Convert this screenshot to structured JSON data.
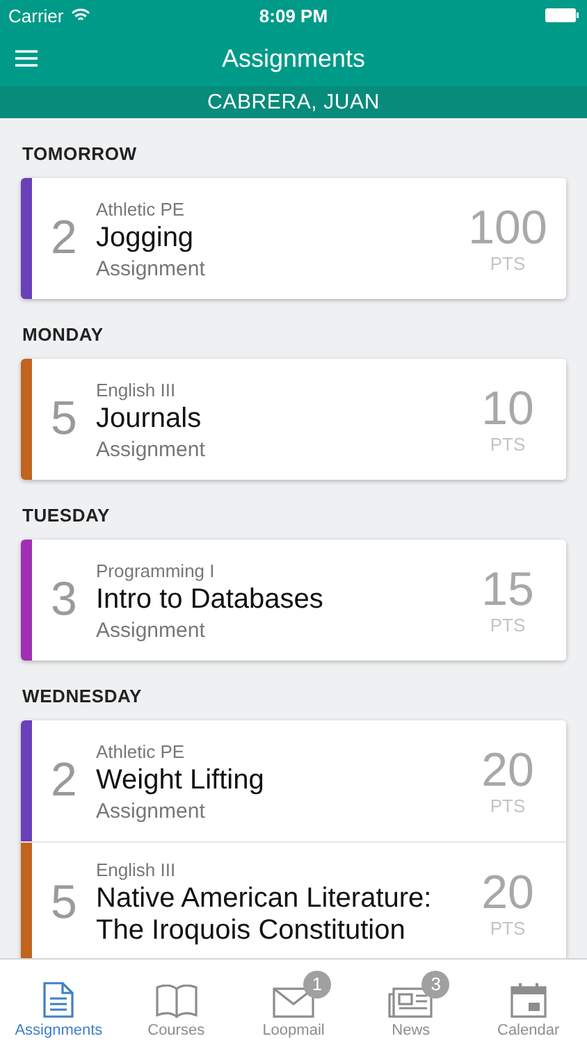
{
  "status_bar": {
    "carrier": "Carrier",
    "time": "8:09 PM"
  },
  "header": {
    "title": "Assignments",
    "student": "CABRERA, JUAN"
  },
  "sections": [
    {
      "day": "TOMORROW",
      "assignments": [
        {
          "number": "2",
          "course": "Athletic PE",
          "title": "Jogging",
          "type": "Assignment",
          "points": "100",
          "unit": "PTS",
          "color": "#6a3fb8"
        }
      ]
    },
    {
      "day": "MONDAY",
      "assignments": [
        {
          "number": "5",
          "course": "English III",
          "title": "Journals",
          "type": "Assignment",
          "points": "10",
          "unit": "PTS",
          "color": "#c0641e"
        }
      ]
    },
    {
      "day": "TUESDAY",
      "assignments": [
        {
          "number": "3",
          "course": "Programming I",
          "title": "Intro to Databases",
          "type": "Assignment",
          "points": "15",
          "unit": "PTS",
          "color": "#a12fb3"
        }
      ]
    },
    {
      "day": "WEDNESDAY",
      "assignments": [
        {
          "number": "2",
          "course": "Athletic PE",
          "title": "Weight Lifting",
          "type": "Assignment",
          "points": "20",
          "unit": "PTS",
          "color": "#6a3fb8"
        },
        {
          "number": "5",
          "course": "English III",
          "title": "Native American Literature: The Iroquois Constitution",
          "points": "20",
          "unit": "PTS",
          "color": "#c0641e"
        }
      ]
    }
  ],
  "tab_bar": [
    {
      "kind": "document",
      "label": "Assignments",
      "selected": true
    },
    {
      "kind": "book",
      "label": "Courses",
      "selected": false
    },
    {
      "kind": "mail",
      "label": "Loopmail",
      "selected": false,
      "badge": "1"
    },
    {
      "kind": "news",
      "label": "News",
      "selected": false,
      "badge": "3"
    },
    {
      "kind": "calendar",
      "label": "Calendar",
      "selected": false
    }
  ]
}
